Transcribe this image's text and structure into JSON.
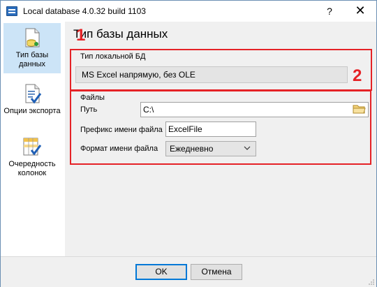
{
  "window": {
    "title": "Local database 4.0.32 build 1103",
    "help_label": "?",
    "close_label": "✕"
  },
  "sidebar": {
    "items": [
      {
        "label": "Тип базы данных",
        "icon": "database-icon",
        "active": true
      },
      {
        "label": "Опции экспорта",
        "icon": "export-options-icon",
        "active": false
      },
      {
        "label": "Очередность колонок",
        "icon": "column-order-icon",
        "active": false
      }
    ]
  },
  "page": {
    "title": "Тип базы данных"
  },
  "annotations": {
    "marker1": "1",
    "marker2": "2",
    "color": "#e52226"
  },
  "db_type": {
    "group_label": "Тип локальной БД",
    "value": "MS Excel напрямую, без OLE"
  },
  "files": {
    "group_label": "Файлы",
    "path_label": "Путь",
    "path_value": "C:\\",
    "prefix_label": "Префикс имени файла",
    "prefix_value": "ExcelFile",
    "format_label": "Формат имени файла",
    "format_value": "Ежедневно"
  },
  "footer": {
    "ok_label": "OK",
    "cancel_label": "Отмена"
  }
}
